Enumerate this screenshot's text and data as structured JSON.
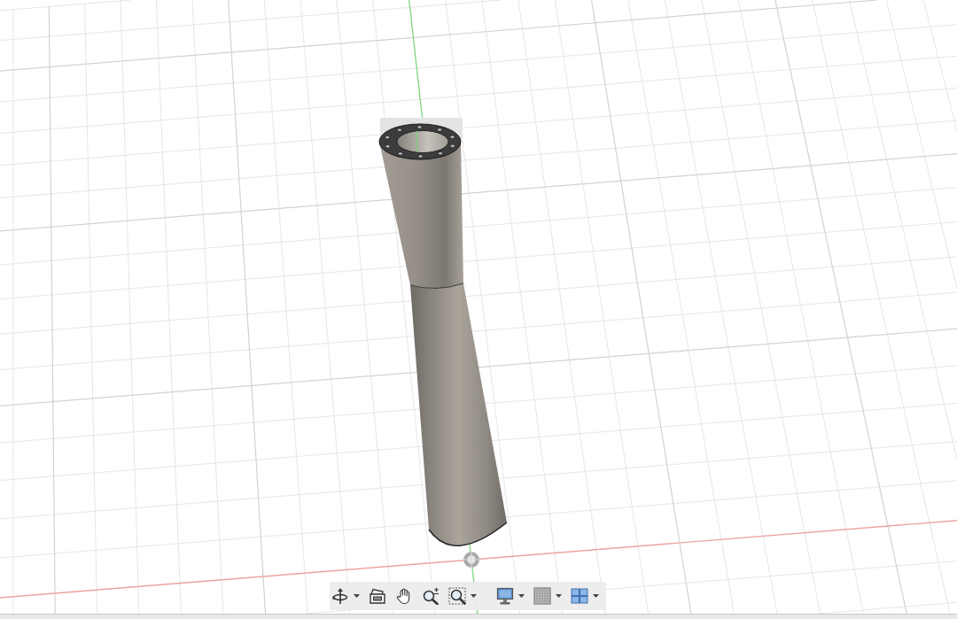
{
  "viewport": {
    "navigation_bar": {
      "groups": [
        {
          "tools": [
            {
              "kind": "orbit",
              "dropdown": true
            },
            {
              "kind": "look-at",
              "dropdown": false
            },
            {
              "kind": "pan",
              "dropdown": false
            },
            {
              "kind": "zoom",
              "dropdown": false
            },
            {
              "kind": "fit",
              "dropdown": true
            }
          ]
        },
        {
          "tools": [
            {
              "kind": "display",
              "dropdown": true
            },
            {
              "kind": "grid",
              "dropdown": true
            },
            {
              "kind": "viewports",
              "dropdown": true
            }
          ]
        }
      ]
    }
  }
}
